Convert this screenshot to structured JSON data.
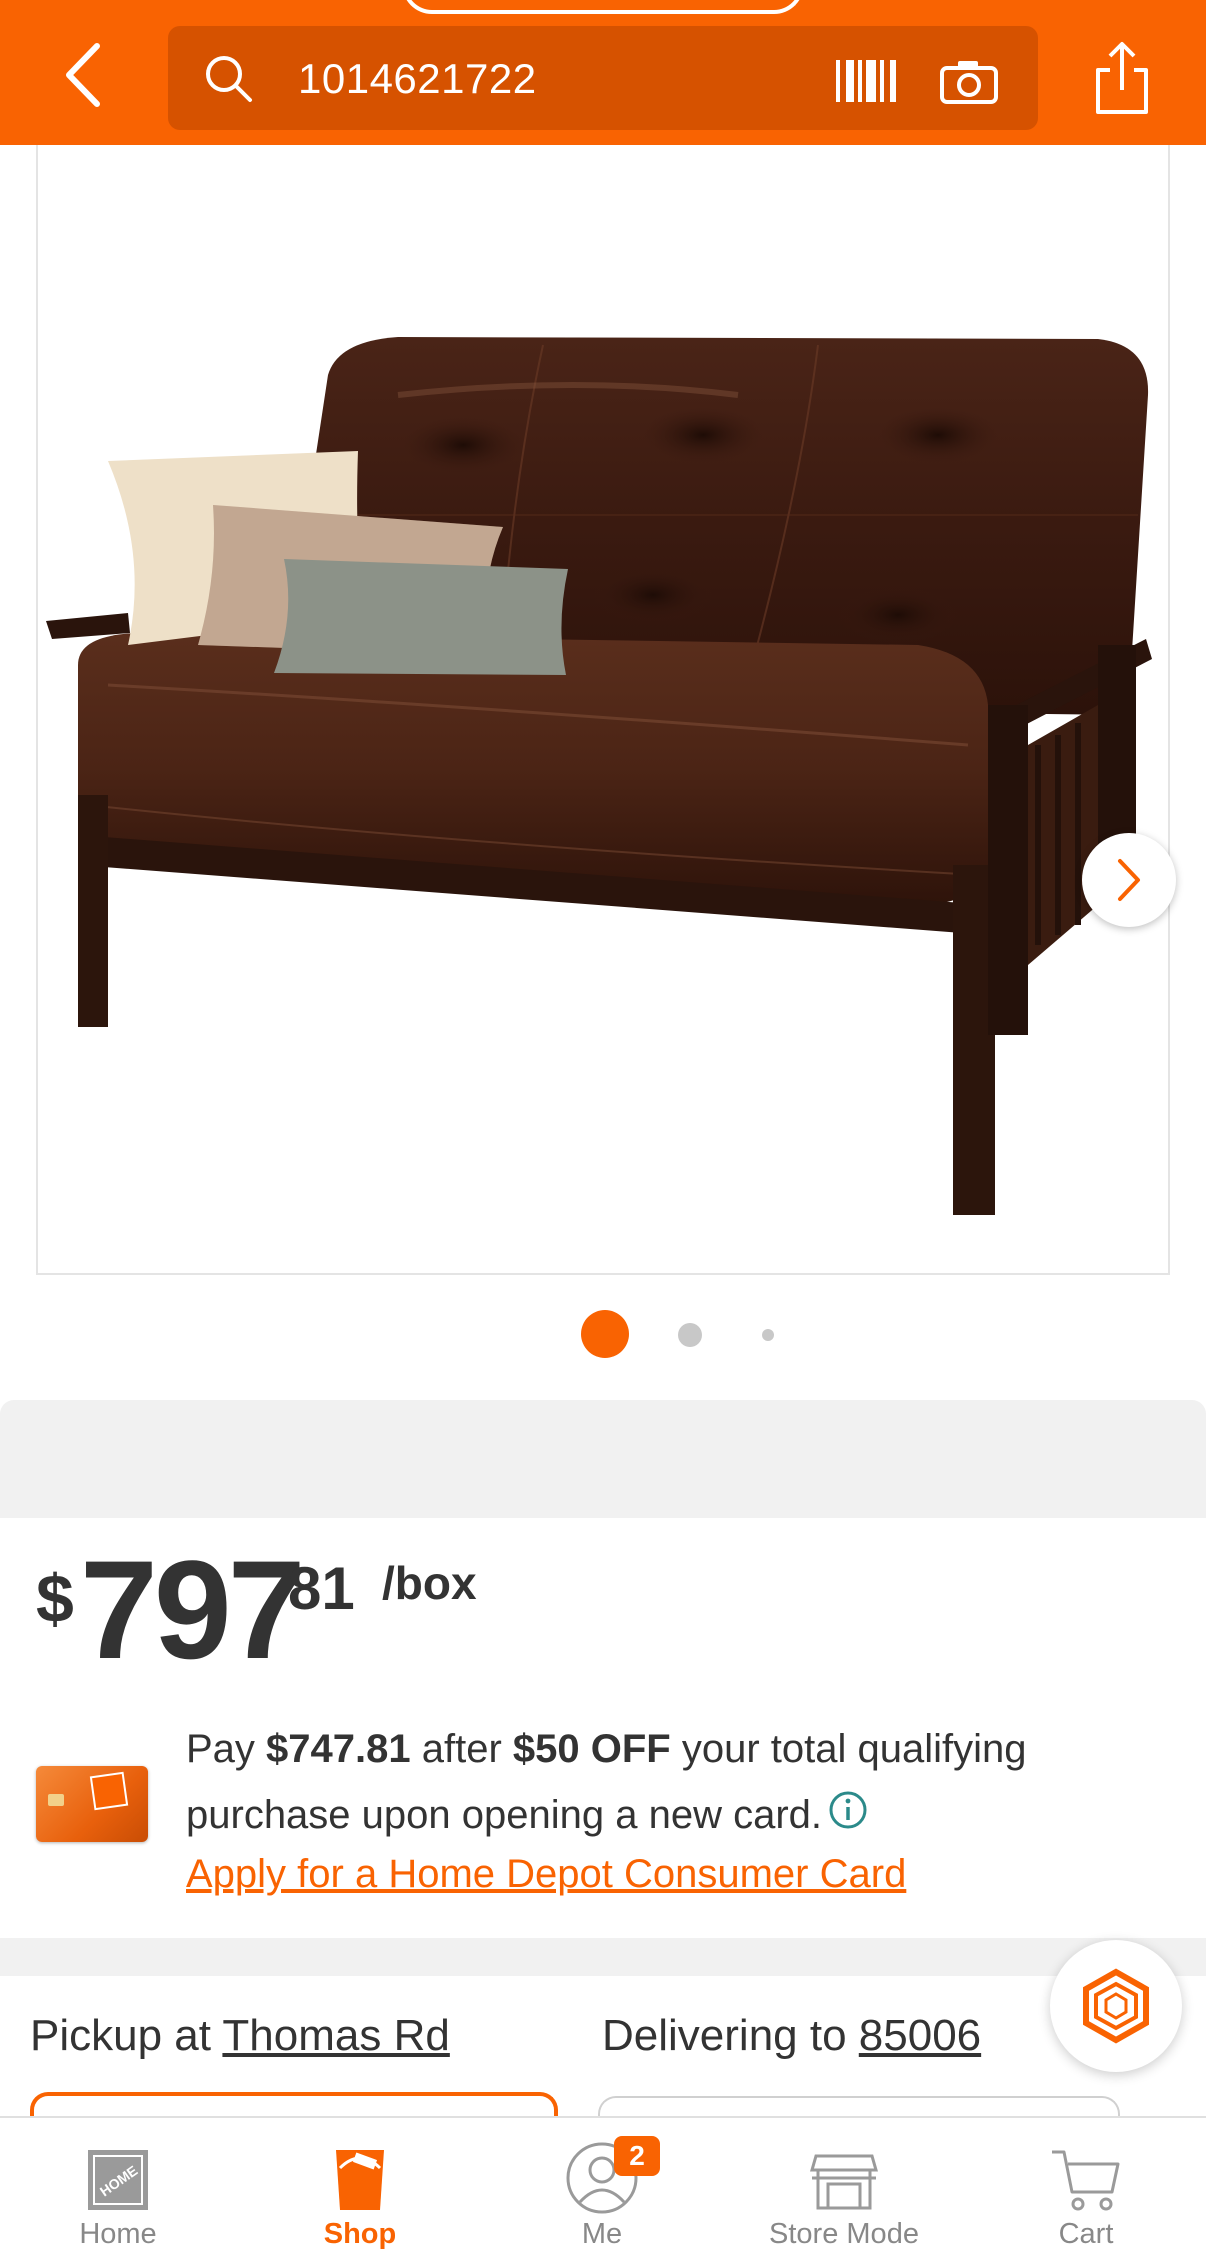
{
  "header": {
    "search_query": "1014621722",
    "back_icon": "chevron-left-icon",
    "search_icon": "search-icon",
    "barcode_icon": "barcode-icon",
    "camera_icon": "camera-icon",
    "share_icon": "share-icon"
  },
  "gallery": {
    "current_image": 1,
    "image_count": 3,
    "next_icon": "chevron-right-icon"
  },
  "price": {
    "dollar_sign": "$",
    "dollars": "797",
    "cents": "81",
    "unit": "/box"
  },
  "promo": {
    "pay": "Pay ",
    "discounted_price": "$747.81",
    "after": " after ",
    "discount": "$50 OFF",
    "rest": " your total qualifying purchase upon opening a new card.",
    "apply_link": "Apply for a Home Depot Consumer Card"
  },
  "fulfillment": {
    "pickup_label": "Pickup at ",
    "pickup_store": "Thomas Rd",
    "delivery_label": "Delivering to ",
    "delivery_zip": "85006"
  },
  "bottom_nav": {
    "items": [
      {
        "label": "Home",
        "icon": "home-depot-logo-icon",
        "active": false
      },
      {
        "label": "Shop",
        "icon": "shop-bucket-icon",
        "active": true
      },
      {
        "label": "Me",
        "icon": "profile-icon",
        "active": false,
        "badge": "2"
      },
      {
        "label": "Store Mode",
        "icon": "store-icon",
        "active": false
      },
      {
        "label": "Cart",
        "icon": "cart-icon",
        "active": false
      }
    ]
  },
  "colors": {
    "brand_orange": "#f96302",
    "search_bg": "#d65200",
    "text": "#333333",
    "muted": "#888888"
  }
}
